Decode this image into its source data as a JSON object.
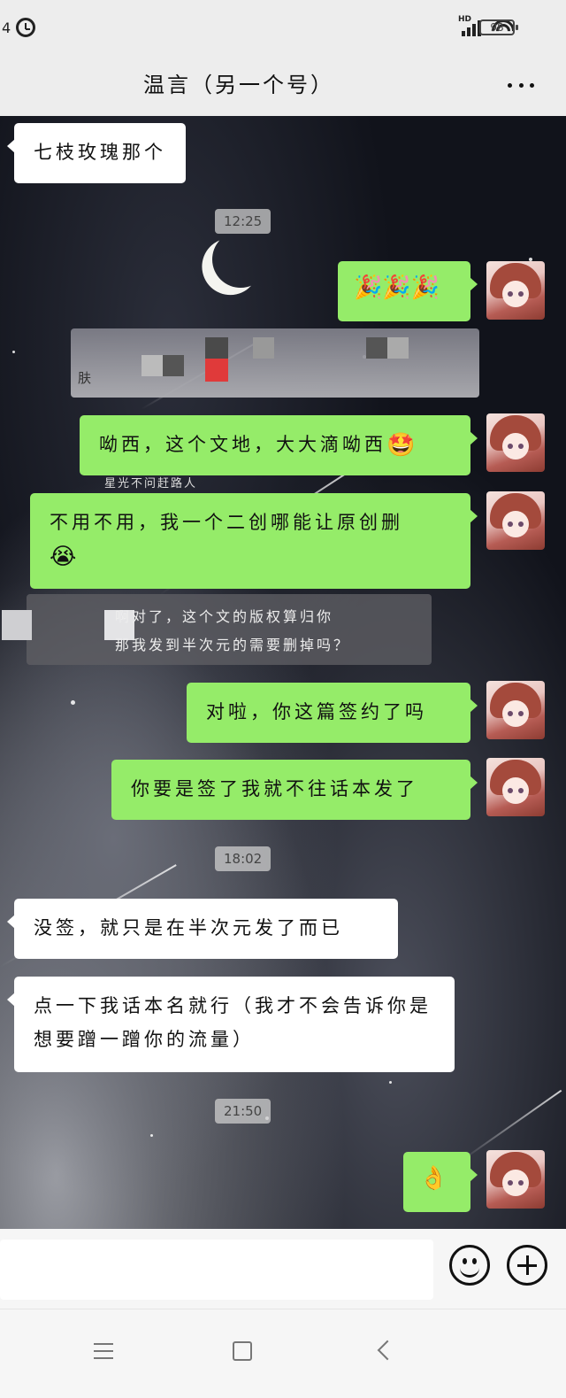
{
  "status_bar": {
    "left_text": "4",
    "alarm_icon": "alarm-clock-icon",
    "network_label": "HD",
    "battery": "98"
  },
  "header": {
    "title": "温言（另一个号）",
    "more_icon": "more-dots-icon"
  },
  "messages": [
    {
      "side": "left",
      "text": "七枝玫瑰那个"
    },
    {
      "type": "time",
      "text": "12:25"
    },
    {
      "side": "right",
      "emoji": "🎉🎉🎉"
    },
    {
      "type": "obscured",
      "cut_text": "肤"
    },
    {
      "side": "right",
      "text": "呦西，这个文地，大大滴呦西",
      "emoji": "🤩"
    },
    {
      "side": "right",
      "text": "不用不用，我一个二创哪能让原创删",
      "emoji": "😭"
    },
    {
      "type": "obscured_card",
      "line1": "啊对了，这个文的版权算归你",
      "line2": "那我发到半次元的需要删掉吗？"
    },
    {
      "side": "right",
      "text": "对啦，你这篇签约了吗"
    },
    {
      "side": "right",
      "text": "你要是签了我就不往话本发了"
    },
    {
      "type": "time",
      "text": "18:02"
    },
    {
      "side": "left",
      "text": "没签，就只是在半次元发了而已"
    },
    {
      "side": "left",
      "text": "点一下我话本名就行（我才不会告诉你是想要蹭一蹭你的流量）"
    },
    {
      "type": "time",
      "text": "21:50"
    },
    {
      "side": "right",
      "emoji": "👌"
    }
  ],
  "background_text": "星光不问赶路人",
  "input_bar": {
    "emoji_icon": "smiley-icon",
    "plus_icon": "plus-circle-icon"
  },
  "nav_bar": {
    "menu_icon": "menu-icon",
    "home_icon": "home-square-icon",
    "back_icon": "back-chevron-icon"
  },
  "colors": {
    "sent_bubble": "#95ec69",
    "received_bubble": "#ffffff",
    "header_bg": "#ededed"
  }
}
